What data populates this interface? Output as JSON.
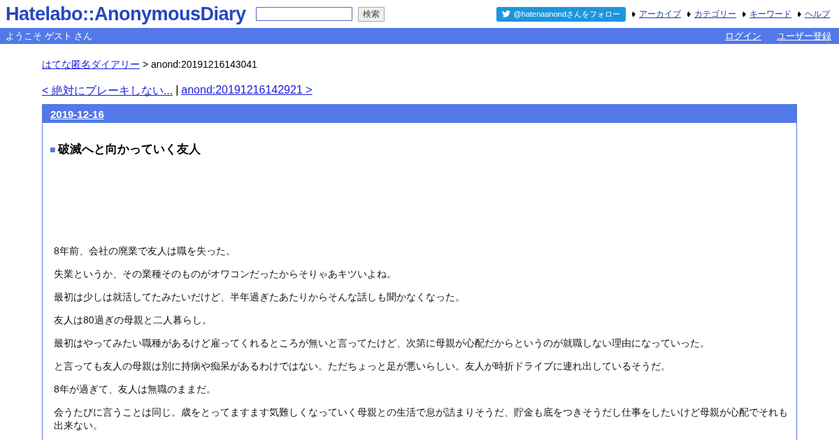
{
  "header": {
    "logo": "Hatelabo::AnonymousDiary",
    "search": {
      "button": "検索"
    },
    "follow_button": "@hatenaanondさんをフォロー",
    "nav": [
      "アーカイブ",
      "カテゴリー",
      "キーワード",
      "ヘルプ"
    ]
  },
  "user_bar": {
    "welcome": "ようこそ ゲスト さん",
    "links": [
      "ログイン",
      "ユーザー登録"
    ]
  },
  "breadcrumb": {
    "link": "はてな匿名ダイアリー",
    "current": "> anond:20191216143041"
  },
  "pager": {
    "prev": "< 絶対にブレーキしない...",
    "separator": "|",
    "next": "anond:20191216142921 >"
  },
  "day": {
    "date": "2019-12-16",
    "section": {
      "marker": "■",
      "title": "破滅へと向かっていく友人",
      "paragraphs": [
        "8年前、会社の廃業で友人は職を失った。",
        "失業というか、その業種そのものがオワコンだったからそりゃあキツいよね。",
        "最初は少しは就活してたみたいだけど、半年過ぎたあたりからそんな話しも聞かなくなった。",
        "友人は80過ぎの母親と二人暮らし。",
        "最初はやってみたい職種があるけど雇ってくれるところが無いと言ってたけど、次第に母親が心配だからというのが就職しない理由になっていった。",
        "と言っても友人の母親は別に持病や痴呆があるわけではない。ただちょっと足が悪いらしい。友人が時折ドライブに連れ出しているそうだ。",
        "8年が過ぎて、友人は無職のままだ。",
        "会うたびに言うことは同じ。歳をとってますます気難しくなっていく母親との生活で息が詰まりそうだ、貯金も底をつきそうだし仕事をしたいけど母親が心配でそれも出来ない。"
      ]
    }
  }
}
